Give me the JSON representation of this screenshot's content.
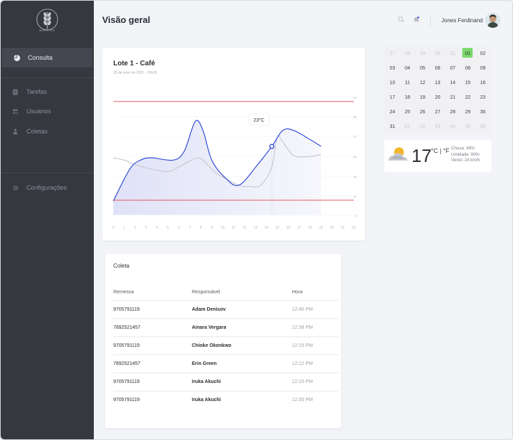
{
  "brand": {
    "logo_text": "AGROTEC"
  },
  "sidebar": {
    "items": [
      {
        "label": "Consulta",
        "icon": "pie-chart-icon",
        "active": true
      },
      {
        "label": "Tarefas",
        "icon": "clipboard-icon",
        "active": false
      },
      {
        "label": "Usuarios",
        "icon": "users-icon",
        "active": false
      },
      {
        "label": "Coletas",
        "icon": "collection-icon",
        "active": false
      },
      {
        "label": "Configurações",
        "icon": "gear-icon",
        "active": false
      }
    ]
  },
  "header": {
    "title": "Visão geral",
    "user_name": "Jones Ferdinand"
  },
  "chart": {
    "title": "Lote 1 - Café",
    "subtitle": "25 de maio de 2021 - 19h26",
    "tooltip": "23°C"
  },
  "chart_data": {
    "type": "line",
    "x": [
      0,
      1,
      2,
      3,
      4,
      5,
      6,
      7,
      8,
      9,
      10,
      11,
      12,
      13,
      14,
      15,
      16,
      17,
      18,
      19,
      20,
      21,
      22
    ],
    "x_ticks": [
      "0",
      "1",
      "2",
      "3",
      "4",
      "5",
      "6",
      "7",
      "8",
      "9",
      "10",
      "11",
      "12",
      "13",
      "14",
      "15",
      "16",
      "17",
      "18",
      "19",
      "20",
      "21",
      "22"
    ],
    "y_ticks": [
      "33",
      "25",
      "22",
      "20",
      "16",
      "12",
      "8"
    ],
    "thresholds": {
      "upper": 33,
      "lower": 12
    },
    "series": [
      {
        "color": "#2f4bd6",
        "points": [
          [
            0,
            11
          ],
          [
            1.5,
            18
          ],
          [
            2.5,
            20
          ],
          [
            3.5,
            20.5
          ],
          [
            5.5,
            20
          ],
          [
            6.5,
            22
          ],
          [
            7.5,
            28.5
          ],
          [
            8.2,
            26.5
          ],
          [
            9,
            20
          ],
          [
            10.2,
            16.2
          ],
          [
            11.5,
            14.5
          ],
          [
            13.2,
            19
          ],
          [
            14.5,
            23
          ],
          [
            15.5,
            26.5
          ],
          [
            16.5,
            26.5
          ],
          [
            18,
            24.5
          ],
          [
            19,
            23
          ]
        ]
      },
      {
        "color": "#c8c9cf",
        "points": [
          [
            0,
            20.5
          ],
          [
            1,
            20
          ],
          [
            2,
            19
          ],
          [
            3.5,
            18
          ],
          [
            5,
            17.5
          ],
          [
            6,
            18.5
          ],
          [
            7,
            19.8
          ],
          [
            8,
            20.3
          ],
          [
            9.5,
            17
          ],
          [
            11.5,
            14.5
          ],
          [
            12.5,
            14.2
          ],
          [
            13.5,
            14.5
          ],
          [
            14.5,
            18.5
          ],
          [
            15,
            25
          ],
          [
            15.5,
            24
          ],
          [
            16.5,
            21
          ],
          [
            18,
            20.8
          ],
          [
            19,
            21.2
          ]
        ]
      }
    ],
    "marker": {
      "x": 14.5,
      "y": 23
    }
  },
  "calendar": {
    "days": [
      [
        "27",
        "28",
        "29",
        "30",
        "31",
        "01",
        "02"
      ],
      [
        "03",
        "04",
        "05",
        "06",
        "07",
        "08",
        "09"
      ],
      [
        "10",
        "11",
        "12",
        "13",
        "14",
        "15",
        "16"
      ],
      [
        "17",
        "18",
        "19",
        "20",
        "21",
        "22",
        "23"
      ],
      [
        "24",
        "25",
        "26",
        "27",
        "28",
        "29",
        "30"
      ],
      [
        "31",
        "01",
        "02",
        "03",
        "04",
        "05",
        "06"
      ]
    ],
    "selected": "01"
  },
  "weather": {
    "temperature": "17",
    "unit": "°C | °F",
    "rain": "Chuva: 34%",
    "humidity": "Umidade: 90%",
    "wind": "Vento: 24 km/h"
  },
  "table": {
    "title": "Coleta",
    "headers": {
      "remessa": "Remessa",
      "responsavel": "Responsável",
      "hora": "Hora"
    },
    "rows": [
      {
        "remessa": "9705791119",
        "responsavel": "Adam Denisov",
        "hora": "12:40 PM"
      },
      {
        "remessa": "7892521457",
        "responsavel": "Ainara Vergara",
        "hora": "12:38 PM"
      },
      {
        "remessa": "9705791119",
        "responsavel": "Chioke Okonkwo",
        "hora": "12:15 PM"
      },
      {
        "remessa": "7892521457",
        "responsavel": "Erin Green",
        "hora": "12:12 PM"
      },
      {
        "remessa": "9705791119",
        "responsavel": "Iruka Akuchi",
        "hora": "12:10 PM"
      },
      {
        "remessa": "9705791119",
        "responsavel": "Iruka Akuchi",
        "hora": "12:05 PM"
      }
    ]
  }
}
